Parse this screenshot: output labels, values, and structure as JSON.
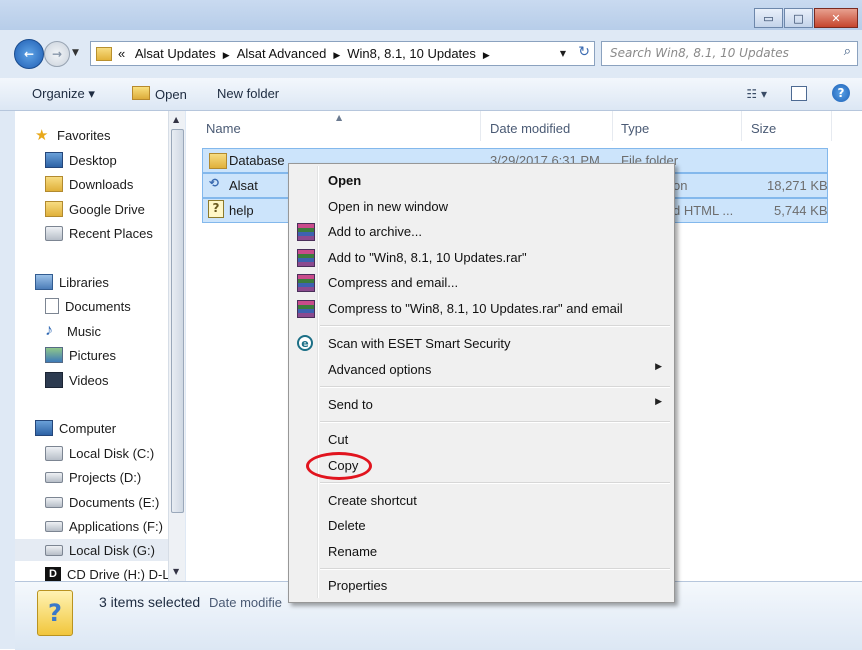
{
  "window": {
    "minimize_label": "▭",
    "maximize_label": "□",
    "close_label": "✕"
  },
  "address_bar": {
    "prefix": "«",
    "crumbs": [
      "Alsat Updates",
      "Alsat Advanced",
      "Win8, 8.1, 10 Updates"
    ],
    "refresh": "↻"
  },
  "search": {
    "placeholder": "Search Win8, 8.1, 10 Updates",
    "icon": "search-icon"
  },
  "toolbar": {
    "organize": "Organize ▾",
    "open": "Open",
    "new_folder": "New folder"
  },
  "nav": {
    "favorites": "Favorites",
    "fav_items": [
      "Desktop",
      "Downloads",
      "Google Drive",
      "Recent Places"
    ],
    "libraries": "Libraries",
    "lib_items": [
      "Documents",
      "Music",
      "Pictures",
      "Videos"
    ],
    "computer": "Computer",
    "comp_items": [
      "Local Disk (C:)",
      "Projects (D:)",
      "Documents (E:)",
      "Applications (F:)",
      "Local Disk (G:)",
      "CD Drive (H:) D-L"
    ]
  },
  "columns": {
    "name": "Name",
    "date_modified": "Date modified",
    "type": "Type",
    "size": "Size"
  },
  "files": [
    {
      "name": "Database",
      "date": "3/29/2017 6:31 PM",
      "type": "File folder",
      "size": ""
    },
    {
      "name": "Alsat",
      "date": "",
      "type": "on",
      "size": "18,271 KB"
    },
    {
      "name": "help",
      "date": "",
      "type": "d HTML ...",
      "size": "5,744 KB"
    }
  ],
  "status": {
    "selected": "3 items selected",
    "date_label": "Date modifie"
  },
  "context_menu": {
    "open": "Open",
    "open_new_window": "Open in new window",
    "add_archive": "Add to archive...",
    "add_rar": "Add to \"Win8, 8.1, 10 Updates.rar\"",
    "compress_email": "Compress and email...",
    "compress_rar_email": "Compress to \"Win8, 8.1, 10 Updates.rar\" and email",
    "scan_eset": "Scan with ESET Smart Security",
    "advanced": "Advanced options",
    "send_to": "Send to",
    "cut": "Cut",
    "copy": "Copy",
    "create_shortcut": "Create shortcut",
    "delete": "Delete",
    "rename": "Rename",
    "properties": "Properties"
  },
  "annotation_color": "#e1141e"
}
